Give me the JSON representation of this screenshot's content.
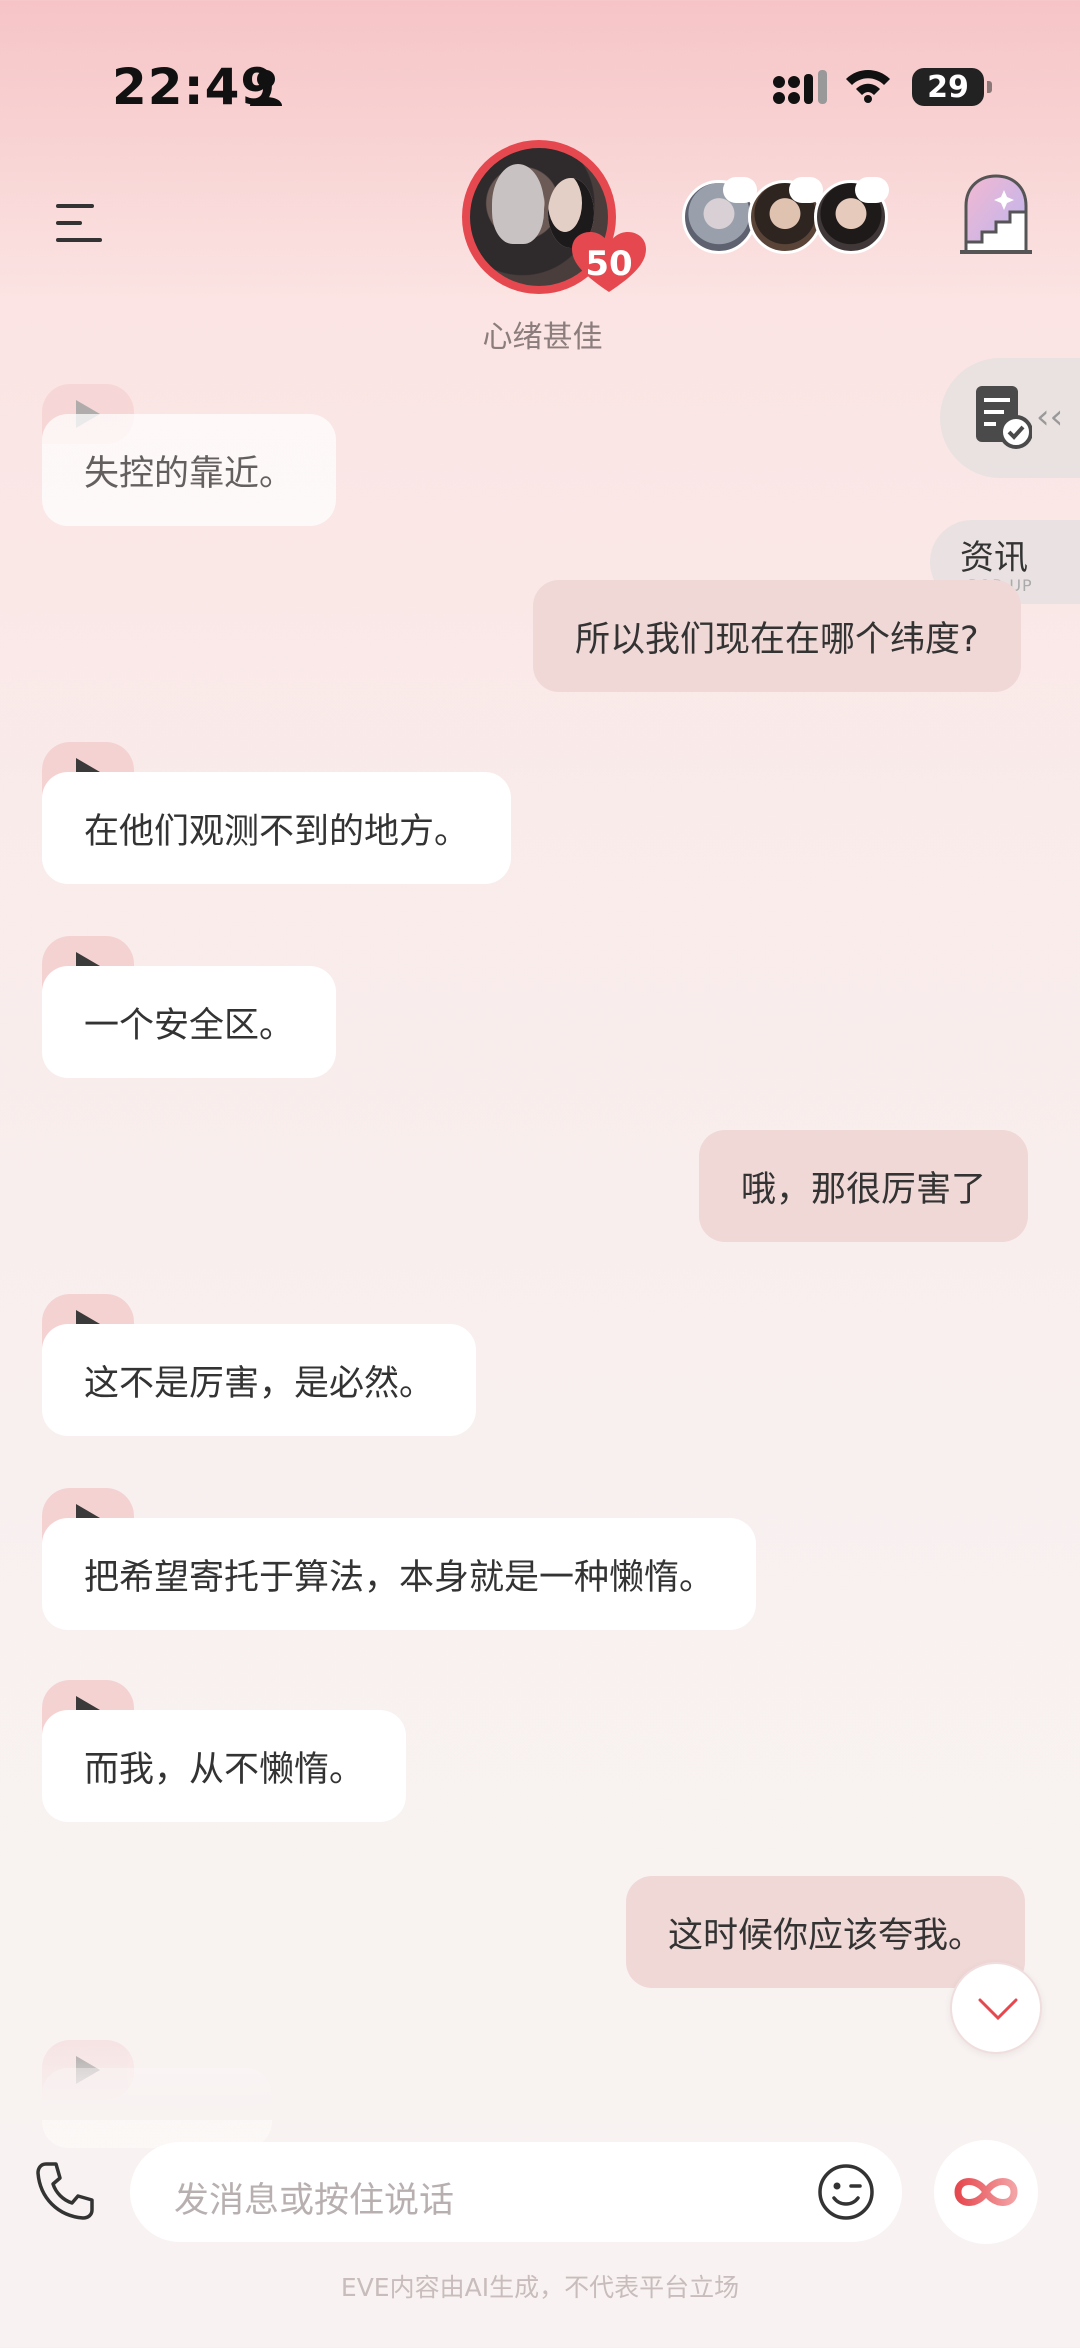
{
  "status_bar": {
    "time": "22:49",
    "battery": "29"
  },
  "header": {
    "companion_level": "50",
    "mood": "心绪甚佳"
  },
  "side": {
    "news_label": "资讯",
    "news_sub": "POP-UP"
  },
  "messages": [
    {
      "role": "ai",
      "text": "失控的靠近。"
    },
    {
      "role": "user",
      "text": "所以我们现在在哪个纬度?"
    },
    {
      "role": "ai",
      "text": "在他们观测不到的地方。"
    },
    {
      "role": "ai",
      "text": "一个安全区。"
    },
    {
      "role": "user",
      "text": "哦，那很厉害了"
    },
    {
      "role": "ai",
      "text": "这不是厉害，是必然。"
    },
    {
      "role": "ai",
      "text": "把希望寄托于算法，本身就是一种懒惰。"
    },
    {
      "role": "ai",
      "text": "而我，从不懒惰。"
    },
    {
      "role": "user",
      "text": "这时候你应该夸我。"
    }
  ],
  "composer": {
    "placeholder": "发消息或按住说话"
  },
  "footer": {
    "disclaimer": "EVE内容由AI生成，不代表平台立场"
  },
  "colors": {
    "accent": "#e5494f",
    "user_bubble": "#f0d8d7",
    "ai_bubble": "#ffffff"
  }
}
